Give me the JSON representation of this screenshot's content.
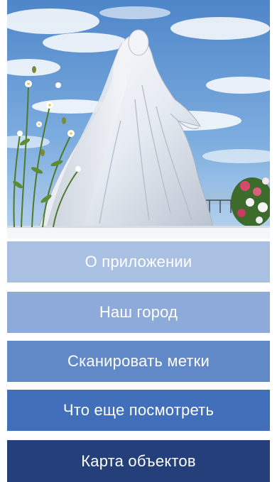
{
  "hero": {
    "image": "white-statue-photo",
    "colors": {
      "sky": "#6b9fd6",
      "statue": "#e9eef5"
    }
  },
  "menu": {
    "items": [
      {
        "label": "О приложении",
        "color": "#a9c0e2"
      },
      {
        "label": "Наш город",
        "color": "#8eaad8"
      },
      {
        "label": "Сканировать метки",
        "color": "#6289c7"
      },
      {
        "label": "Что еще посмотреть",
        "color": "#416fba"
      },
      {
        "label": "Карта объектов",
        "color": "#243f79"
      }
    ]
  }
}
